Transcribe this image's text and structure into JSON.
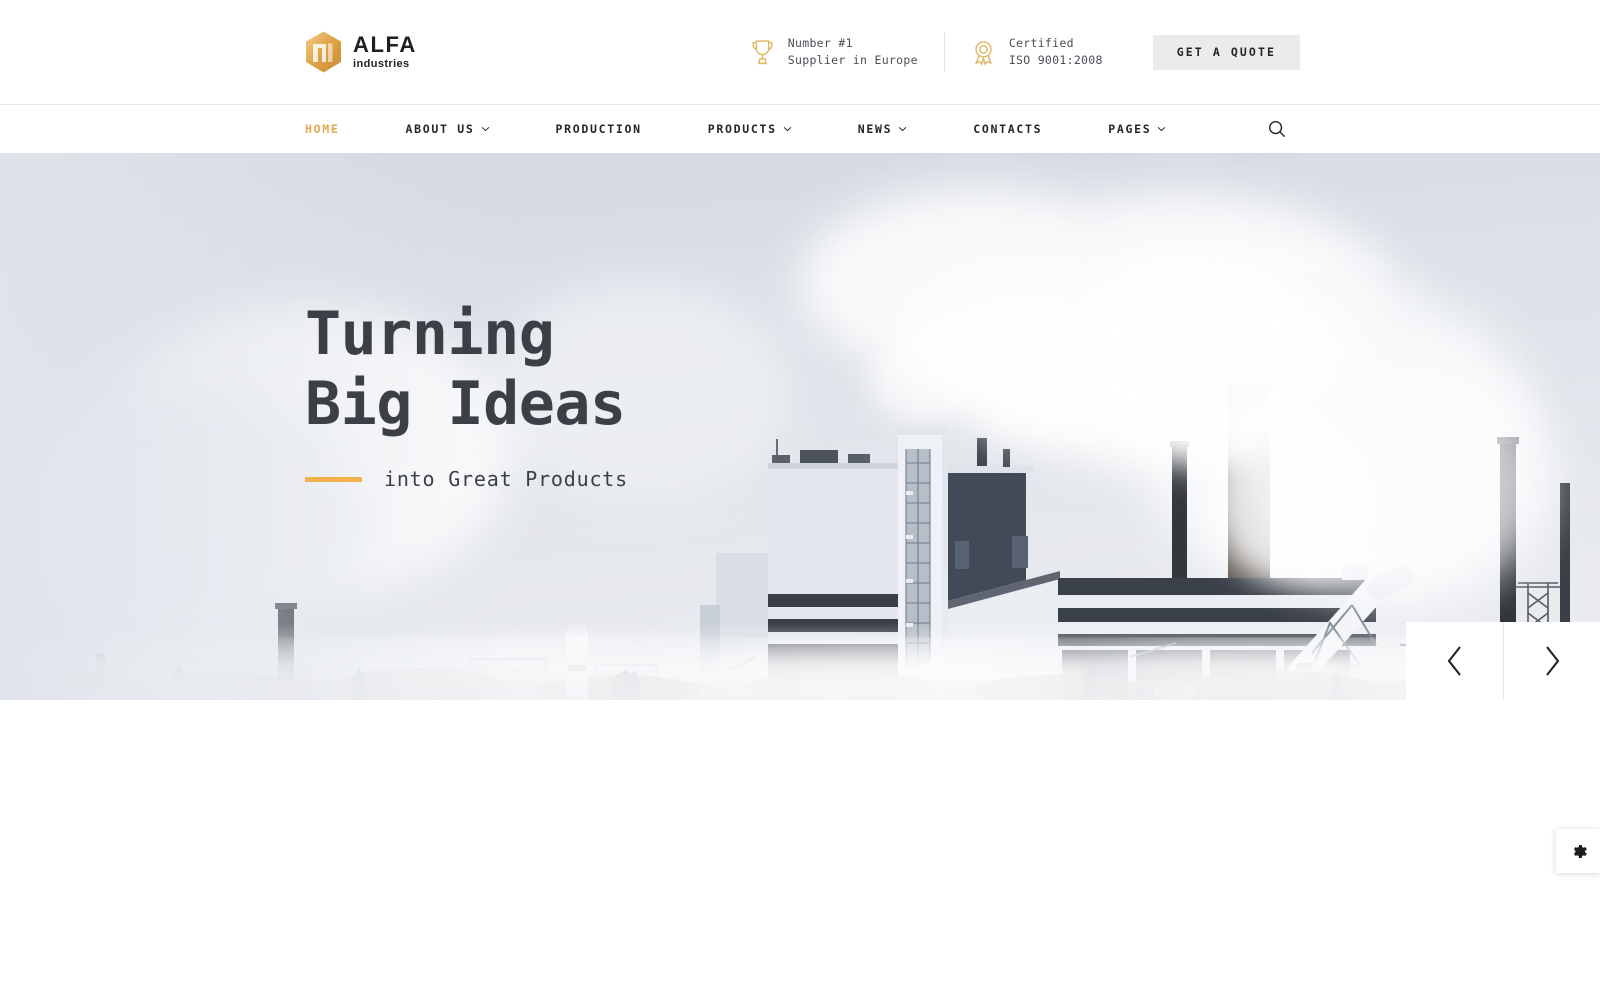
{
  "brand": {
    "logo_icon": "hexagon-logo-icon",
    "title": "ALFA",
    "subtitle": "industries",
    "accent_color": "#e3a94a",
    "logo_gold": "#e0a54a"
  },
  "header": {
    "badges": [
      {
        "icon": "trophy-icon",
        "line1": "Number #1",
        "line2": "Supplier in Europe"
      },
      {
        "icon": "award-ribbon-icon",
        "line1": "Certified",
        "line2": "ISO 9001:2008"
      }
    ],
    "quote_button": {
      "label": "GET A QUOTE",
      "icon": "none"
    }
  },
  "nav": {
    "items": [
      {
        "label": "HOME",
        "has_caret": false,
        "active": true
      },
      {
        "label": "ABOUT US",
        "has_caret": true,
        "active": false
      },
      {
        "label": "PRODUCTION",
        "has_caret": false,
        "active": false
      },
      {
        "label": "PRODUCTS",
        "has_caret": true,
        "active": false
      },
      {
        "label": "NEWS",
        "has_caret": true,
        "active": false
      },
      {
        "label": "CONTACTS",
        "has_caret": false,
        "active": false
      },
      {
        "label": "PAGES",
        "has_caret": true,
        "active": false
      }
    ],
    "search_icon": "search-icon"
  },
  "hero": {
    "headline_line1": "Turning",
    "headline_line2": "Big Ideas",
    "subheadline": "into Great Products",
    "dash_color": "#f0b14e",
    "text_color": "#3c3f45",
    "image_alt": "industrial pulp mill factory with smoke stacks in winter fog",
    "prev_icon": "chevron-left-icon",
    "next_icon": "chevron-right-icon"
  },
  "settings": {
    "icon": "gear-icon"
  }
}
